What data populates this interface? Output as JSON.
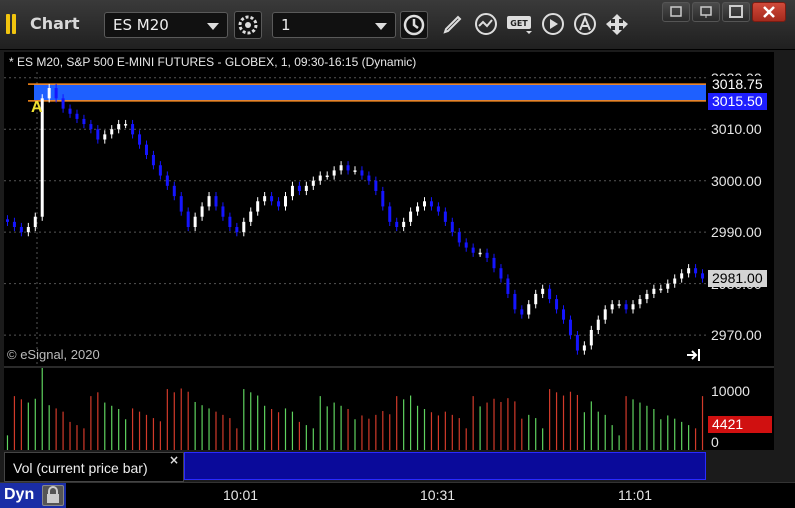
{
  "window": {
    "title": "Chart",
    "symbol": "ES M20",
    "interval": "1",
    "toolbar_icons": [
      "link-gear-icon",
      "clock-icon",
      "pencil-icon",
      "indicator-icon",
      "get-icon",
      "play-icon",
      "alert-icon",
      "move-icon"
    ],
    "window_controls": [
      "restore-icon",
      "tile-icon",
      "maximize-icon",
      "close-icon"
    ]
  },
  "chart": {
    "caption": "* ES M20, S&P 500 E-MINI FUTURES - GLOBEX, 1, 09:30-16:15 (Dynamic)",
    "copyright": "© eSignal, 2020",
    "marker": "A",
    "price_labels": [
      "3020.00",
      "3010.00",
      "3000.00",
      "2990.00",
      "2980.00",
      "2970.00"
    ],
    "price_tags": [
      {
        "value": "3018.75",
        "color": "#ffffff",
        "bg": "#000000"
      },
      {
        "value": "3015.50",
        "color": "#ffffff",
        "bg": "#1e1eff"
      },
      {
        "value": "2981.00",
        "color": "#000000",
        "bg": "#d4d4d4"
      }
    ],
    "time_labels": [
      "10:01",
      "10:31",
      "11:01"
    ],
    "colors": {
      "up": "#ffffff",
      "down": "#1515ff",
      "band": "#1e60ff",
      "band_border": "#ff8c1a",
      "volume_up": "#5fd35f",
      "volume_down": "#d23a2a",
      "grid": "#555555"
    }
  },
  "chart_data": {
    "type": "candlestick",
    "ylim": [
      2964,
      3025
    ],
    "yticks": [
      3020,
      3010,
      3000,
      2990,
      2980,
      2970
    ],
    "band": {
      "high": 3018.75,
      "low": 3015.5
    },
    "last": 2981.0,
    "closes": [
      2992,
      2991,
      2990,
      2991,
      2993,
      3016,
      3018,
      3016,
      3014,
      3013,
      3012,
      3011,
      3010,
      3008,
      3009,
      3010,
      3011,
      3011,
      3009,
      3007,
      3005,
      3003,
      3001,
      2999,
      2997,
      2994,
      2991,
      2993,
      2995,
      2997,
      2995,
      2993,
      2991,
      2990,
      2992,
      2994,
      2996,
      2997,
      2996,
      2995,
      2997,
      2999,
      2998,
      2999,
      3000,
      3001,
      3001,
      3002,
      3003,
      3002,
      3002,
      3001,
      3000,
      2998,
      2995,
      2992,
      2991,
      2992,
      2994,
      2995,
      2996,
      2995,
      2994,
      2992,
      2990,
      2988,
      2987,
      2986,
      2986,
      2985,
      2983,
      2981,
      2978,
      2975,
      2974,
      2976,
      2978,
      2979,
      2977,
      2975,
      2973,
      2970,
      2967,
      2968,
      2971,
      2973,
      2975,
      2976,
      2976,
      2975,
      2976,
      2977,
      2978,
      2979,
      2979,
      2980,
      2981,
      2982,
      2983,
      2982,
      2981
    ],
    "volume": {
      "ylim": [
        0,
        14000
      ],
      "yticks": [
        10000,
        0
      ],
      "last": "4421"
    },
    "volume_label": "Vol (current price bar)",
    "interval_mode": "Dyn"
  }
}
